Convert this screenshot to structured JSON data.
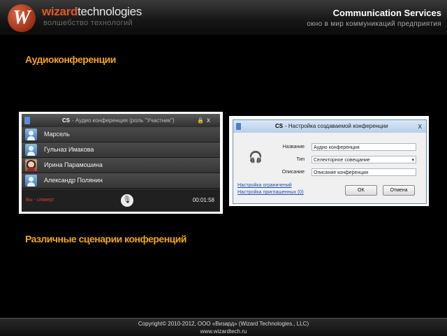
{
  "header": {
    "logo_letter": "W",
    "brand_wizard": "wizard",
    "brand_tech": "technologies",
    "brand_sub": "волшебство технологий",
    "service_title": "Communication Services",
    "service_sub": "окно в мир коммуникаций предприятия"
  },
  "section1_title": "Аудиоконференции",
  "section2_title": "Различные сценарии конференций",
  "conference_window": {
    "title_cs": "CS",
    "title_rest": " - Аудио конференция (роль \"Участник\")",
    "lock_icon": "lock-icon",
    "close": "x",
    "participants": [
      {
        "name": "Марсель",
        "avatar": "person-icon"
      },
      {
        "name": "Гульназ Имакова",
        "avatar": "person-icon"
      },
      {
        "name": "Ирина Парамошина",
        "avatar": "photo"
      },
      {
        "name": "Александр Полянин",
        "avatar": "person-icon"
      }
    ],
    "status": "Вы - спикер!",
    "mic_icon": "microphone-icon",
    "timer": "00:01:58"
  },
  "settings_dialog": {
    "title_cs": "CS",
    "title_rest": " - Настройка создаваемой конференции",
    "close": "x",
    "icon": "headset-icon",
    "fields": {
      "name_label": "Название",
      "name_value": "Аудио конференция",
      "type_label": "Тип",
      "type_value": "Селекторное совещание",
      "desc_label": "Описание",
      "desc_value": "Описание конференции"
    },
    "link_limits": "Настройка ограничений",
    "link_invites": "Настройка приглашенных (0)",
    "ok": "OK",
    "cancel": "Отмена"
  },
  "footer": {
    "copyright": "Copyright© 2010-2012, ООО «Визард» (Wizard Technologies., LLC)",
    "url": "www.wizardtech.ru"
  },
  "colors": {
    "accent": "#f2a51c",
    "brand": "#e0582a",
    "status": "#e23b3b"
  }
}
